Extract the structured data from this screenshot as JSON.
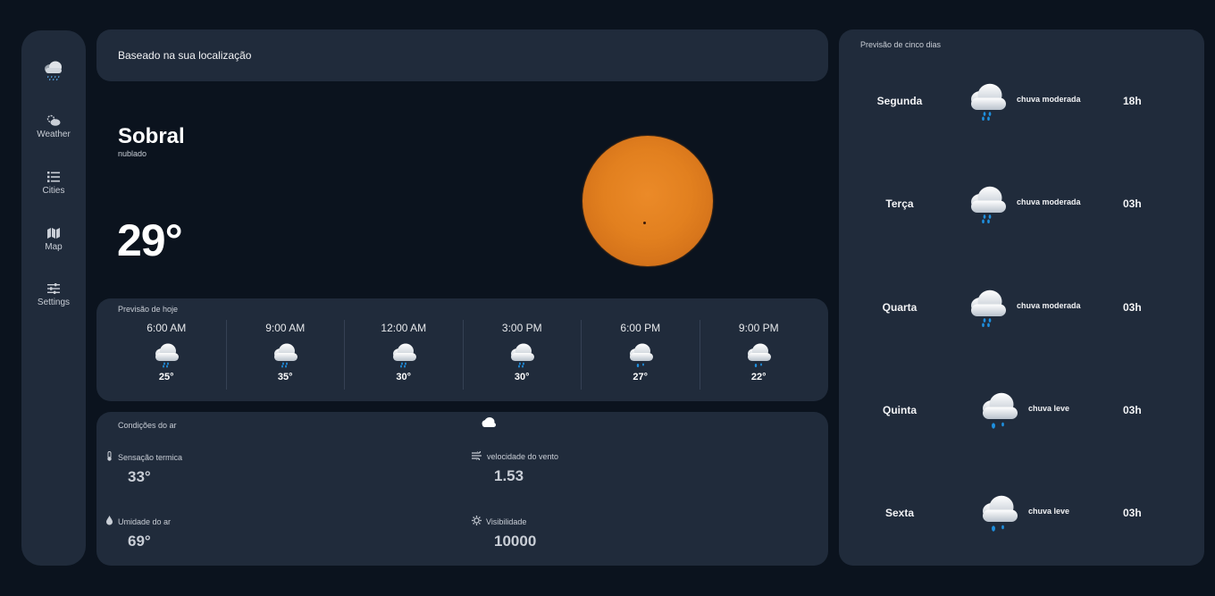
{
  "sidebar": {
    "logo_icon": "cloud-rain-icon",
    "items": [
      {
        "label": "Weather",
        "icon": "cloud-sun-icon"
      },
      {
        "label": "Cities",
        "icon": "list-icon"
      },
      {
        "label": "Map",
        "icon": "map-icon"
      },
      {
        "label": "Settings",
        "icon": "sliders-icon"
      }
    ]
  },
  "location": {
    "text": "Baseado na sua localização"
  },
  "current": {
    "city": "Sobral",
    "condition": "nublado",
    "temperature": "29°",
    "image": "sun-image"
  },
  "today": {
    "title": "Previsão de hoje",
    "hours": [
      {
        "time": "6:00 AM",
        "temp": "25°",
        "icon": "cloud-rain-icon"
      },
      {
        "time": "9:00 AM",
        "temp": "35°",
        "icon": "cloud-rain-icon"
      },
      {
        "time": "12:00 AM",
        "temp": "30°",
        "icon": "cloud-rain-icon"
      },
      {
        "time": "3:00 PM",
        "temp": "30°",
        "icon": "cloud-rain-icon"
      },
      {
        "time": "6:00 PM",
        "temp": "27°",
        "icon": "cloud-drizzle-icon"
      },
      {
        "time": "9:00 PM",
        "temp": "22°",
        "icon": "cloud-drizzle-icon"
      }
    ]
  },
  "air": {
    "title": "Condições do ar",
    "metrics": [
      {
        "label": "Sensação termica",
        "value": "33°",
        "icon": "thermometer-icon"
      },
      {
        "label": "velocidade do vento",
        "value": "1.53",
        "icon": "wind-icon"
      },
      {
        "label": "Umidade do ar",
        "value": "69°",
        "icon": "droplet-icon"
      },
      {
        "label": "Visibilidade",
        "value": "10000",
        "icon": "sun-gear-icon"
      }
    ]
  },
  "five_day": {
    "title": "Previsão de cinco dias",
    "days": [
      {
        "day": "Segunda",
        "desc": "chuva moderada",
        "hour": "18h",
        "icon": "cloud-rain-icon"
      },
      {
        "day": "Terça",
        "desc": "chuva moderada",
        "hour": "03h",
        "icon": "cloud-rain-icon"
      },
      {
        "day": "Quarta",
        "desc": "chuva moderada",
        "hour": "03h",
        "icon": "cloud-rain-icon"
      },
      {
        "day": "Quinta",
        "desc": "chuva leve",
        "hour": "03h",
        "icon": "cloud-drizzle-icon"
      },
      {
        "day": "Sexta",
        "desc": "chuva leve",
        "hour": "03h",
        "icon": "cloud-drizzle-icon"
      }
    ]
  },
  "colors": {
    "background": "#0b131e",
    "panel": "#202b3b",
    "sun": "#e2801f",
    "rain": "#1e90e0"
  }
}
